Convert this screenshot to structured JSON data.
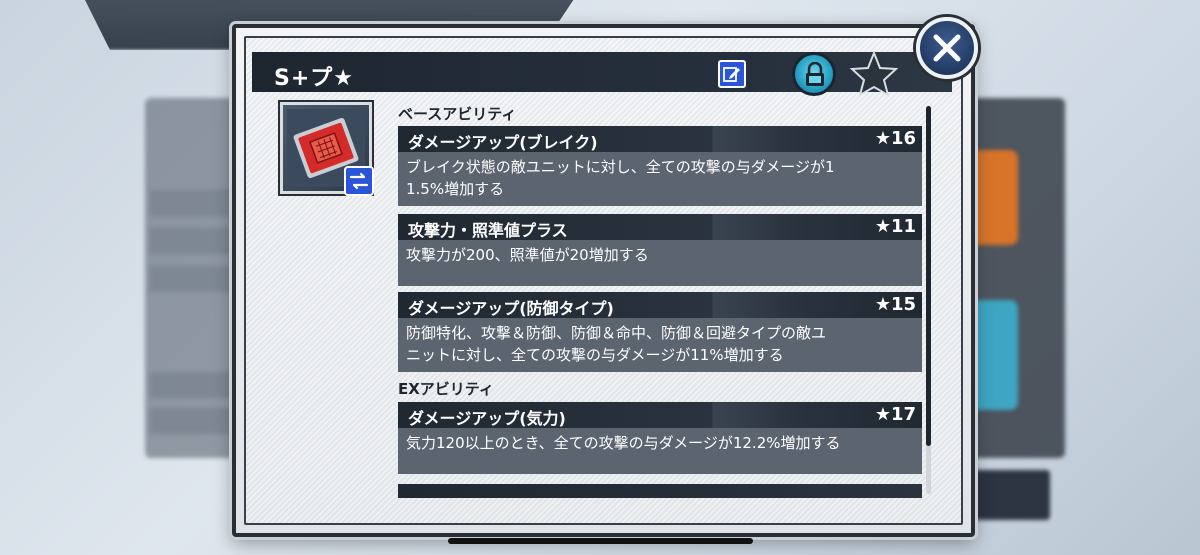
{
  "dialog": {
    "title": "S+プ★"
  },
  "icons": {
    "edit": "edit-icon",
    "lock": "lock-icon",
    "favorite": "star-icon",
    "close": "close-icon",
    "swap": "swap-icon",
    "chip": "chip-icon"
  },
  "base_abilities": {
    "label": "ベースアビリティ",
    "items": [
      {
        "name": "ダメージアップ(ブレイク)",
        "stars": "★16",
        "lines": [
          "ブレイク状態の敵ユニットに対し、全ての攻撃の与ダメージが1",
          "1.5%増加する"
        ]
      },
      {
        "name": "攻撃力・照準値プラス",
        "stars": "★11",
        "lines": [
          "攻撃力が200、照準値が20増加する",
          ""
        ]
      },
      {
        "name": "ダメージアップ(防御タイプ)",
        "stars": "★15",
        "lines": [
          "防御特化、攻撃＆防御、防御＆命中、防御＆回避タイプの敵ユ",
          "ニットに対し、全ての攻撃の与ダメージが11%増加する"
        ]
      }
    ]
  },
  "ex_abilities": {
    "label": "EXアビリティ",
    "items": [
      {
        "name": "ダメージアップ(気力)",
        "stars": "★17",
        "lines": [
          "気力120以上のとき、全ての攻撃の与ダメージが12.2%増加する",
          ""
        ]
      }
    ]
  },
  "colors": {
    "accent_blue": "#2b55d9",
    "lock_cyan": "#29a4c7",
    "header_dark": "#202831",
    "body_gray": "#5c6470"
  }
}
